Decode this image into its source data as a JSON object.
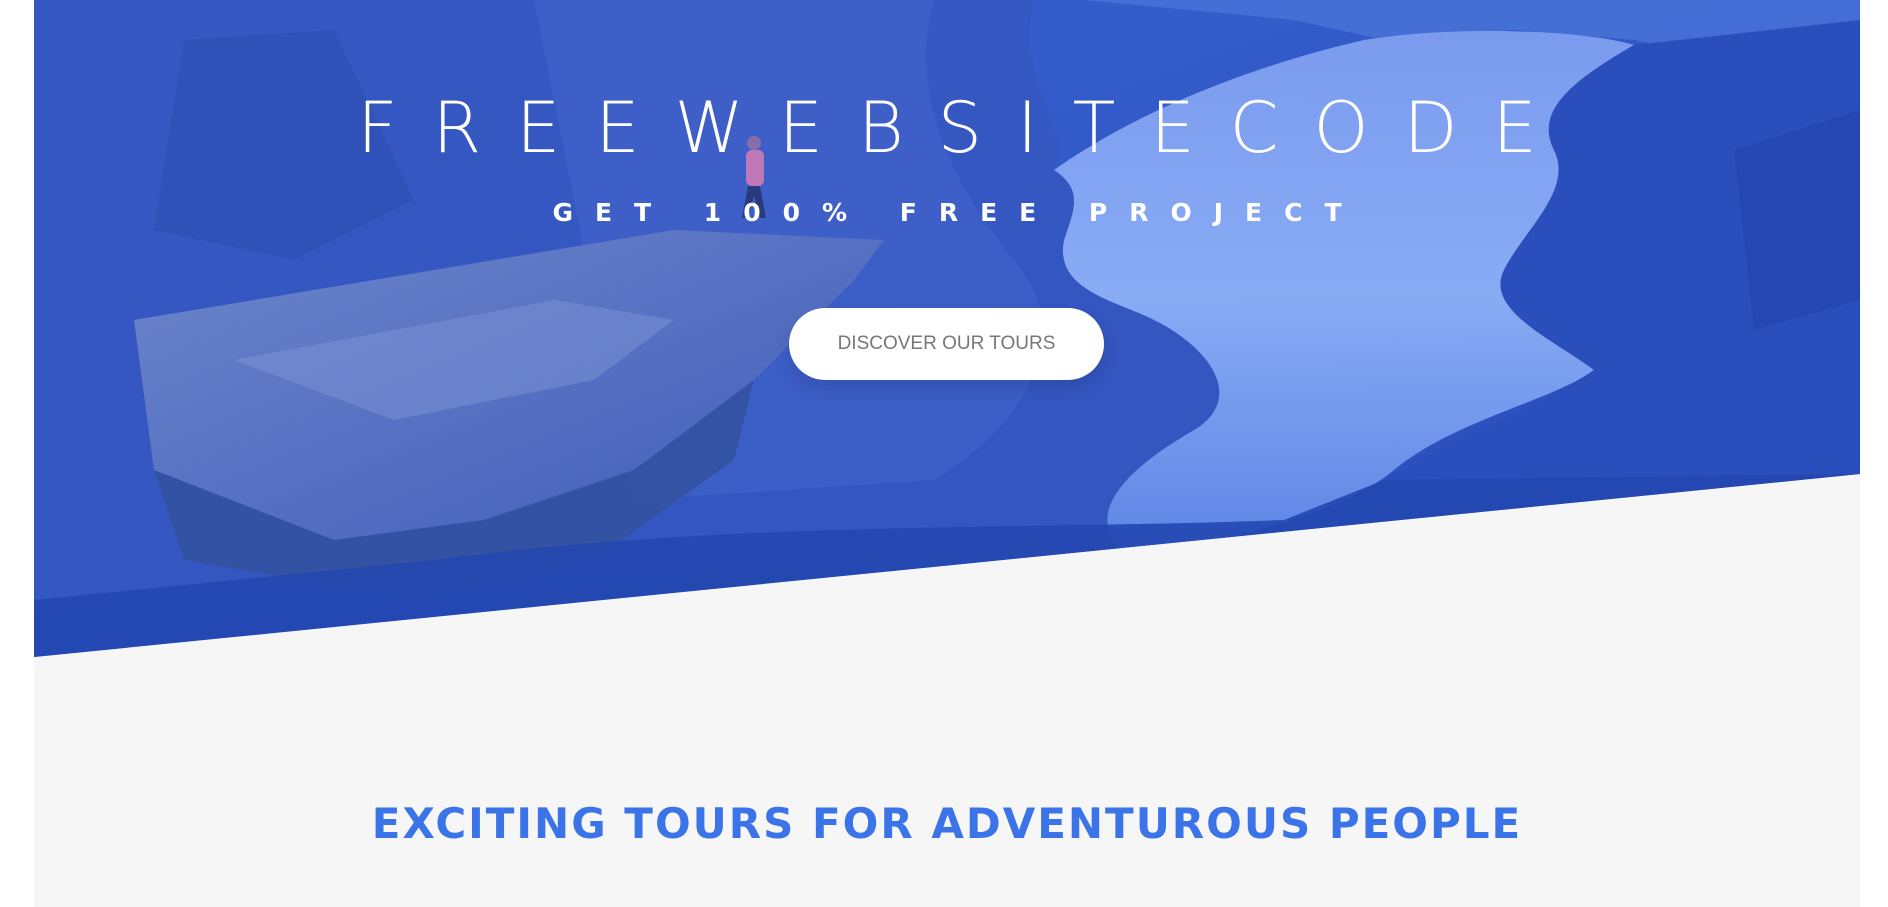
{
  "hero": {
    "title": "FREEWEBSITECODE",
    "subtitle": "GET 100% FREE PROJECT",
    "cta_label": "DISCOVER OUR TOURS",
    "overlay_color": "#2f57c9"
  },
  "section": {
    "heading": "EXCITING TOURS FOR ADVENTUROUS PEOPLE",
    "heading_color": "#3b73e8",
    "background": "#f6f6f6"
  }
}
